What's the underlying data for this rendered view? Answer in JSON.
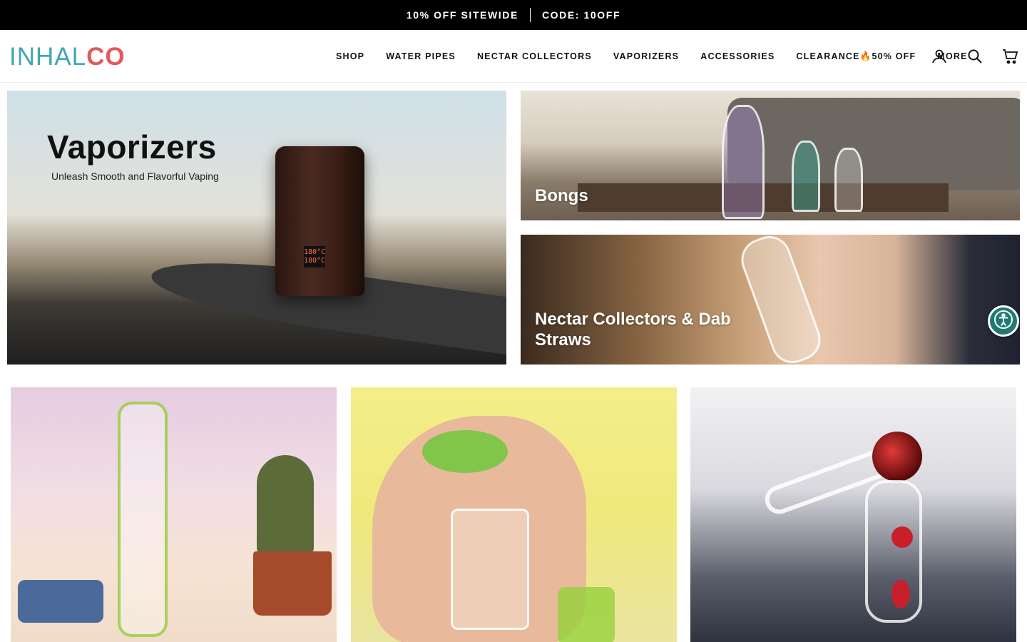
{
  "announcement": {
    "offer": "10% OFF SITEWIDE",
    "code": "CODE: 10OFF"
  },
  "logo": {
    "text_part1": "INHAL",
    "text_part2": "CO",
    "color_primary": "#3fa7b3",
    "color_accent": "#e05a5a"
  },
  "nav": {
    "items": [
      {
        "label": "SHOP"
      },
      {
        "label": "WATER PIPES"
      },
      {
        "label": "NECTAR COLLECTORS"
      },
      {
        "label": "VAPORIZERS"
      },
      {
        "label": "ACCESSORIES"
      },
      {
        "label": "CLEARANCE🔥50% OFF"
      },
      {
        "label": "MORE"
      }
    ]
  },
  "header_icons": [
    "account-icon",
    "search-icon",
    "cart-icon"
  ],
  "hero": {
    "vaporizers": {
      "title": "Vaporizers",
      "subtitle": "Unleash Smooth and Flavorful Vaping",
      "device_screen": "180°C\n180°C"
    },
    "bongs": {
      "label": "Bongs"
    },
    "nectar": {
      "label": "Nectar Collectors & Dab Straws"
    }
  },
  "products": [
    {
      "name": "product-image-1"
    },
    {
      "name": "product-image-2"
    },
    {
      "name": "product-image-3"
    }
  ],
  "accessibility": {
    "icon": "accessibility-icon",
    "color": "#1f7a73"
  }
}
